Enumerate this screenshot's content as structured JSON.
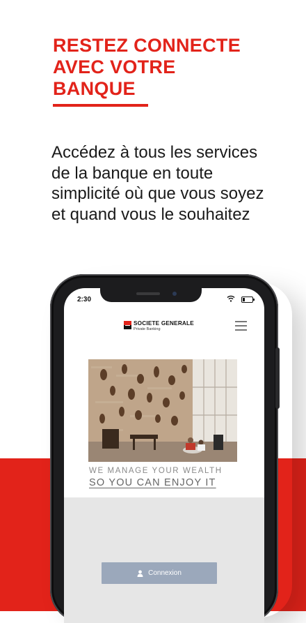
{
  "promo": {
    "headline_lines": [
      "RESTEZ CONNECTE",
      "AVEC VOTRE",
      "BANQUE"
    ],
    "subtitle_lines": [
      "Accédez à tous les services",
      "de la banque en toute",
      "simplicité où que vous soyez",
      "et quand vous le souhaitez"
    ]
  },
  "status_bar": {
    "time": "2:30"
  },
  "app": {
    "logo_name": "SOCIETE GENERALE",
    "logo_sub": "Private Banking",
    "tagline_line1": "WE MANAGE YOUR WEALTH",
    "tagline_line2": "SO YOU CAN ENJOY IT",
    "login_button": "Connexion",
    "icons": [
      "menu-icon",
      "user-icon",
      "wifi-icon",
      "battery-icon"
    ]
  },
  "colors": {
    "brand_red": "#e2231a",
    "button": "#9ba8bb",
    "grey_panel": "#e6e6e6"
  }
}
